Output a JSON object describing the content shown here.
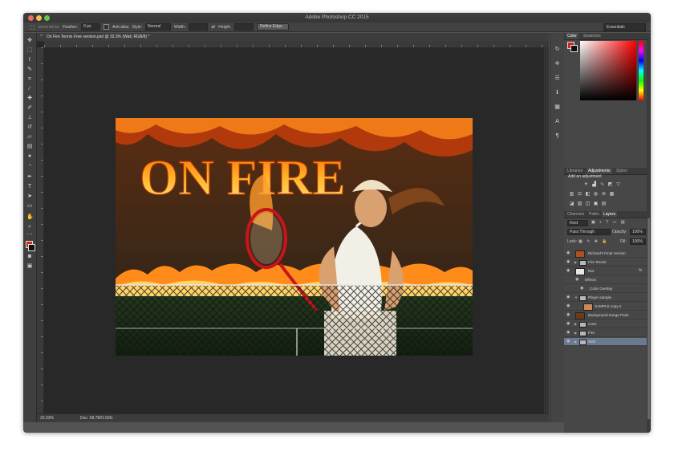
{
  "window": {
    "title": "Adobe Photoshop CC 2015"
  },
  "options_bar": {
    "feather_label": "Feather:",
    "feather_value": "0 px",
    "antialias_label": "Anti-alias",
    "style_label": "Style:",
    "style_value": "Normal",
    "width_label": "Width:",
    "height_label": "Height:",
    "refine_button": "Refine Edge...",
    "workspace": "Essentials"
  },
  "document": {
    "tab_title": "On Fire Tennis Free version.psd @ 33.3% (Wall, RGB/8) *",
    "artwork_text": "ON FIRE",
    "zoom": "33.33%",
    "doc_size": "Doc: 68.7M/1.59G"
  },
  "colors": {
    "foreground": "#d0261d",
    "background": "#111111",
    "selection": "#6b7a8f"
  },
  "toolbar": {
    "icons": [
      "move-icon",
      "marquee-icon",
      "lasso-icon",
      "quick-select-icon",
      "crop-icon",
      "eyedropper-icon",
      "healing-icon",
      "brush-icon",
      "stamp-icon",
      "history-brush-icon",
      "eraser-icon",
      "gradient-icon",
      "blur-icon",
      "dodge-icon",
      "pen-icon",
      "type-icon",
      "path-select-icon",
      "shape-icon",
      "hand-icon",
      "zoom-icon",
      "edit-toolbar-icon"
    ]
  },
  "panels": {
    "color_tabs": [
      "Color",
      "Swatches"
    ],
    "adjust_tabs": [
      "Libraries",
      "Adjustments",
      "Styles"
    ],
    "add_adjustment": "Add an adjustment",
    "layer_tabs": [
      "Channels",
      "Paths",
      "Layers"
    ],
    "kind_filter": "Kind",
    "blend_mode": "Pass Through",
    "opacity_label": "Opacity:",
    "opacity_value": "100%",
    "lock_label": "Lock:",
    "fill_label": "Fill:",
    "fill_value": "100%",
    "layers": [
      {
        "name": "Richard's Final Version",
        "type": "pixel",
        "selected": false
      },
      {
        "name": "Fire Tennis",
        "type": "group",
        "selected": false
      },
      {
        "name": "Net",
        "type": "pixel",
        "selected": false,
        "fx": true
      },
      {
        "name": "Effects",
        "type": "effects",
        "selected": false
      },
      {
        "name": "Color Overlay",
        "type": "effect",
        "selected": false
      },
      {
        "name": "Player sample",
        "type": "group-open",
        "selected": false
      },
      {
        "name": "SAMPLE copy 2",
        "type": "pixel",
        "selected": false
      },
      {
        "name": "Background merge Paint",
        "type": "pixel",
        "selected": false
      },
      {
        "name": "court",
        "type": "group",
        "selected": false
      },
      {
        "name": "Fire",
        "type": "group",
        "selected": false
      },
      {
        "name": "Wall",
        "type": "group",
        "selected": true
      }
    ]
  }
}
